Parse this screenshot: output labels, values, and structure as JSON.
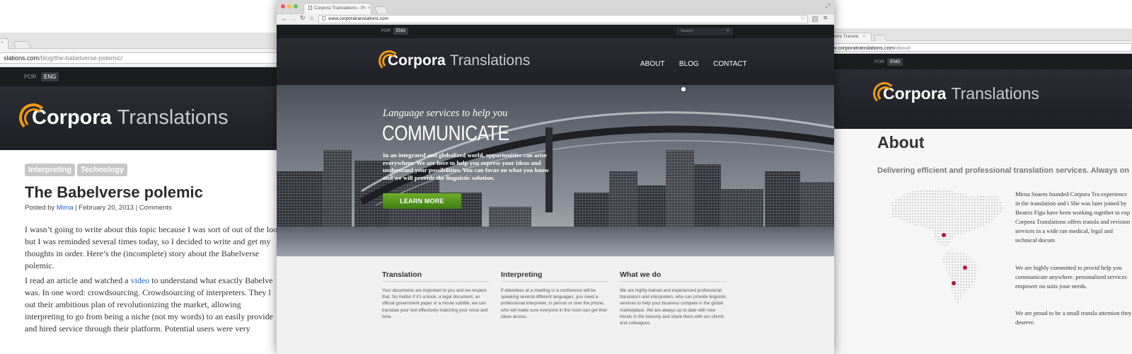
{
  "left_window": {
    "url_domain": "slations.com",
    "url_path": "/blog/the-babelverse-polemic/",
    "close_glyph": "×",
    "lang_por": "POR",
    "lang_eng": "ENG",
    "logo_bold": "Corpora",
    "logo_light": "Translations",
    "tags": [
      "Interpreting",
      "Technology"
    ],
    "post_title": "The Babelverse polemic",
    "meta_prefix": "Posted by",
    "meta_author": "Mirna",
    "meta_sep1": "|",
    "meta_date": "February 20, 2013",
    "meta_sep2": "|",
    "meta_comments": "Comments",
    "para1": "I wasn’t going to write about this topic because I was sort of out of the loo but I was reminded several times today, so I decided to write and get my thoughts in order.  Here’s the (incomplete) story about the Babelverse polemic.",
    "para2_a": "I read an article and watched a ",
    "para2_link": "video",
    "para2_b": " to understand what exactly Babelve was. In one word: crowdsourcing.  Crowdsourcing of interpreters.  They l out their ambitious plan of revolutionizing the market,  allowing interpreting to go from being a niche (not my words) to an easily provide and hired service through their platform.  Potential users were very"
  },
  "center_window": {
    "tab_title": "Corpora Translations - Pr",
    "tab_close": "×",
    "url": "www.corporatranslations.com",
    "lang_por": "POR",
    "lang_eng": "ENG",
    "search_placeholder": "Search",
    "logo_bold": "Corpora",
    "logo_light": "Translations",
    "nav": [
      "ABOUT",
      "BLOG",
      "CONTACT"
    ],
    "hero_tagline": "Language services to help you",
    "hero_title": "COMMUNICATE",
    "hero_body": "In an integrated and globalized world, opportunities can arise everywhere. We are here to help you express your ideas and understand your possibilities. You can focus on what you know and we will provide the linguistic solution.",
    "hero_button": "LEARN MORE",
    "columns": [
      {
        "title": "Translation",
        "body": "Your documents are important to you and we respect that. No matter if it’s a book, a legal document, an official government paper or a movie subtitle, we can translate your text effectively matching your voice and tone."
      },
      {
        "title": "Interpreting",
        "body": "If attendees at a meeting or a conference will be speaking several different languages, you need a professional interpreter, in person or over the phone, who will make sure everyone in the room can get their ideas across."
      },
      {
        "title": "What we do",
        "body": "We are highly-trained and experienced professional translators and interpreters, who can provide linguistic services to help your business compete in the global marketplace. We are always up to date with new trends in the industry and share them with our clients and colleagues."
      }
    ]
  },
  "right_window": {
    "tab_title": "rpora Transla",
    "tab_close": "×",
    "url_domain": "w.corporatranslations.com",
    "url_path": "/about/",
    "lang_por": "POR",
    "lang_eng": "ENG",
    "logo_bold": "Corpora",
    "logo_light": "Translations",
    "page_title": "About",
    "subtitle": "Delivering efficient and professional translation services. Always on",
    "about_p1": "Mirna Soares founded Corpora Tra experience in the translation and i She was later joined by Beatriz Figu have been working together to exp Corpora Translations offers transla and revision services in a wide ran medical, legal and technical docum",
    "about_p2": "We are highly committed to provid help you communicate anywhere. personalized services empower ou suits your needs.",
    "about_p3": "We are proud to be a small transla attention they deserve."
  },
  "colors": {
    "dark_bar": "#1b1c20",
    "header_dark": "#25272d",
    "logo_orange": "#f39a12",
    "button_green": "#4f8f1a",
    "tag_grey": "#c7c7c7",
    "link_blue": "#1f5fbf",
    "map_marker": "#b3123a"
  },
  "icons": [
    "back-arrow-icon",
    "forward-arrow-icon",
    "reload-icon",
    "home-icon",
    "page-icon",
    "star-icon",
    "menu-icon",
    "search-icon",
    "close-icon",
    "traffic-light-icon",
    "fullscreen-icon"
  ]
}
